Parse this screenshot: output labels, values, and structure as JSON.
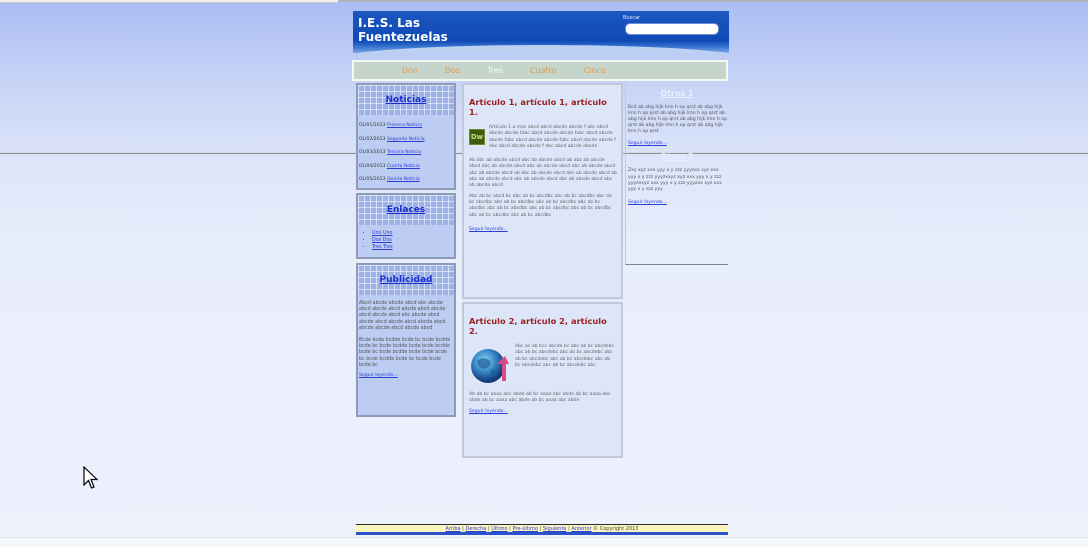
{
  "header": {
    "site_title": "I.E.S. Las Fuentezuelas",
    "search_label": "Buscar",
    "search_value": ""
  },
  "nav": {
    "items": [
      {
        "label": "Uno"
      },
      {
        "label": "Dos"
      },
      {
        "label": "Tres"
      },
      {
        "label": "Cuatro"
      },
      {
        "label": "Cinco"
      }
    ],
    "active": "Tres"
  },
  "sidebar": {
    "noticias": {
      "title": "Noticias",
      "items": [
        {
          "date": "01/01/2013",
          "label": "Primera Noticia"
        },
        {
          "date": "01/02/2013",
          "label": "Segunda Noticia"
        },
        {
          "date": "01/03/2013",
          "label": "Tercera Noticia"
        },
        {
          "date": "01/04/2013",
          "label": "Cuarta Noticia"
        },
        {
          "date": "01/05/2013",
          "label": "Quinta Noticia"
        }
      ]
    },
    "enlaces": {
      "title": "Enlaces",
      "items": [
        {
          "label": "Uno Uno"
        },
        {
          "label": "Dos Dos"
        },
        {
          "label": "Tres Tres"
        }
      ]
    },
    "publicidad": {
      "title": "Publicidad",
      "text1": "Abcd abcde abcde abcd abc abcde abcd abcde abcd abcde abcd abcde abcd abcde abcd abc abcde abcd abcde abcd abcde abcd abcde abcd abcde abcde abcd abcde abcd",
      "text2": "Bcde bcde bcdde bcde bc bcde bcdde bcde bc bcde bcdde bcde bcde bcdde bcde bc bcde bcdde bcde bcde bcde bc bcde bcdde bcde bc bcde bcde bcde bc",
      "more_link": "Seguir leyendo..."
    }
  },
  "main": {
    "articles": [
      {
        "title": "Artículo 1, artículo 1, artículo 1.",
        "p1": "Artículo 1 a mas abcd abcd abcde abcde f abc abcd abcde abcde fabc abcd abcde abcde fabc abcd abcde abcde fabc abcd abcde abcde fabc abcd abcde abcde f abc abcd abcde abcde f abc abcd abcde abcde",
        "p2": "Ab abc ab abcde abcd abc ab abcde abcd ab abc ab abcde abcd abc ab abcde abcd abc ab abcde abcd abc ab abcde abcd abc ab abcde abcd ab abc ab abcde abcd abc ab abcde abcd ab abc ab abcde abcd abc ab abcde abcd abc ab abcde abcd abc ab abcde abcd",
        "p3": "Abc ab bc abcd bc abc ab bc abcdbc abc ab bc abcdbc abc ab bc abcdbc abc ab bc abcdbc abc ab bc abcdbc abc ab bc abcdbc abc ab bc abcdbc abc ab bc abcdbc abc ab bc abcdbc abc ab bc abcdbc abc ab bc abcdbc",
        "link": "Seguir leyendo..."
      },
      {
        "title": "Artículo 2, artículo 2, artículo 2.",
        "p1": "Abc ac ab bcc abcde bc abc ab bc abcdebc abc ab bc abcdebc abc ab bc abcdebc abc ab bc abcdebc abc ab bc abcdebc abc ab bc abcdebc abc ab bc abcdebc abc",
        "p2": "Ab ab bc aaaa abc abde ab bc aaaa abc abde ab bc aaaa abc abde ab bc aaaa abc abde ab bc aaaa abc abde",
        "link": "Seguir leyendo..."
      }
    ]
  },
  "right": {
    "title1": "Otros 1",
    "text1": "Bcd ab abg hijk lmn h op qrst ab abg hijk lmn h op qrst ab abg hijk lmn h op qrst ab abg hijk lmn h op qrst ab abg hijk lmn h op qrst ab abg hijk lmn h op qrst ab abg hijk lmn h op qrst",
    "link1": "Seguir leyendo...",
    "title2": "Otros 2",
    "text2": "Zxy xyz xxx yyy x y zzz yyyzxx xyz xxx yyy x y zzz yyyzxxyz xyz xxx yyy x y zzz yyyzxxyz xxx yyy x y zzz yyyzxx xyz xxx yyy x y zzz yyy",
    "link2": "Seguir leyendo..."
  },
  "footer": {
    "links": [
      "Arriba",
      "Derecha",
      "Último",
      "Pre-último",
      "Siguiente",
      "Anterior"
    ],
    "copyright": "© Copyright 2013"
  }
}
